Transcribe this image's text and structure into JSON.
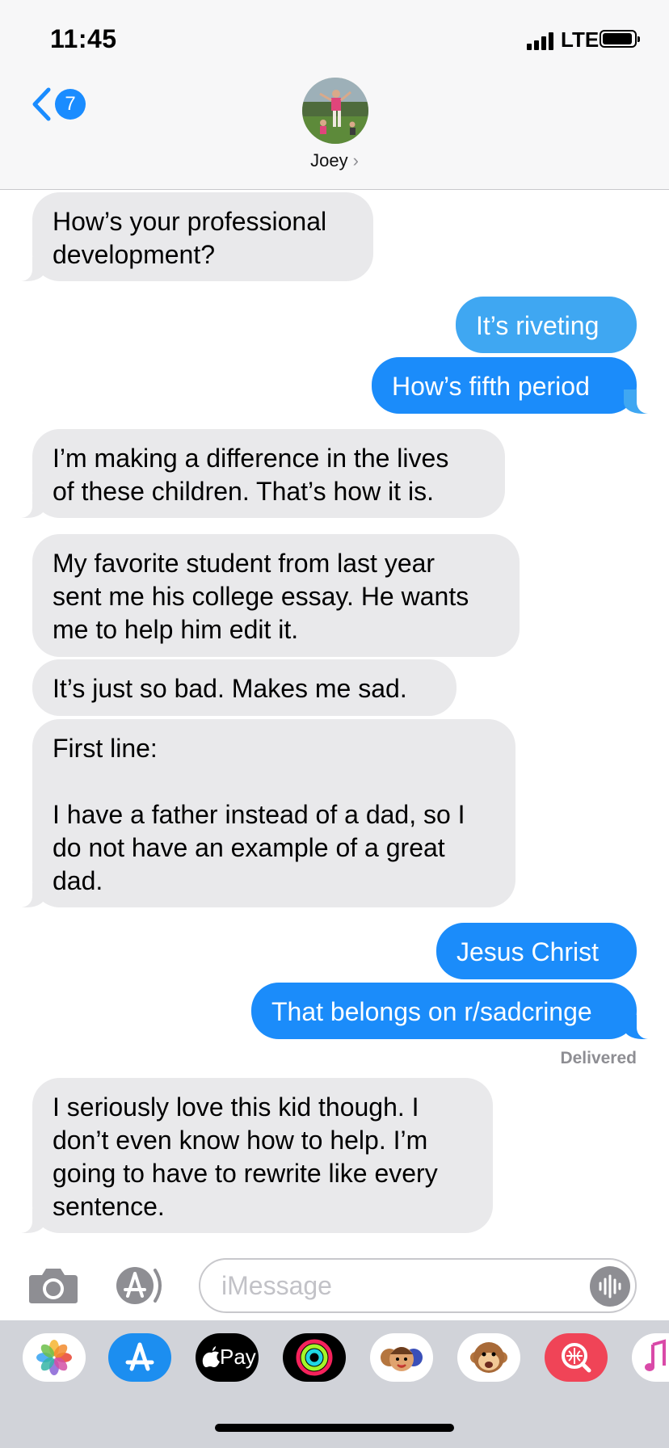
{
  "status_bar": {
    "time": "11:45",
    "network": "LTE"
  },
  "nav": {
    "unread_count": "7",
    "contact_name": "Joey",
    "chevron": "›"
  },
  "messages": [
    {
      "from": "them",
      "text": "How’s your professional\ndevelopment?"
    },
    {
      "from": "me",
      "text": "It’s riveting"
    },
    {
      "from": "me",
      "text": "How’s fifth period"
    },
    {
      "from": "them",
      "text": "I’m making a difference in the lives\nof these children. That’s how it is."
    },
    {
      "from": "them",
      "text": "My favorite student from last year\nsent me his college essay. He wants\nme to help him edit it."
    },
    {
      "from": "them",
      "text": "It’s just so bad. Makes me sad."
    },
    {
      "from": "them",
      "text": "First line:\n\nI have a father instead of a dad, so I\ndo not have an example of a great\ndad."
    },
    {
      "from": "me",
      "text": "Jesus Christ"
    },
    {
      "from": "me",
      "text": "That belongs on r/sadcringe"
    },
    {
      "from": "them",
      "text": "I seriously love this kid though. I\ndon’t even know how to help. I’m\ngoing to have to rewrite like every\nsentence."
    }
  ],
  "delivery_status": "Delivered",
  "composer": {
    "placeholder": "iMessage"
  },
  "app_drawer": {
    "items": [
      "photos",
      "app-store",
      "apple-pay",
      "activity",
      "memoji-stickers",
      "animoji",
      "web-images",
      "music"
    ],
    "apple_pay_label": "Pay"
  },
  "colors": {
    "outgoing": "#1b8cfa",
    "outgoing_light": "#3fa7f2",
    "incoming": "#e9e9eb",
    "badge": "#1a8cff"
  }
}
